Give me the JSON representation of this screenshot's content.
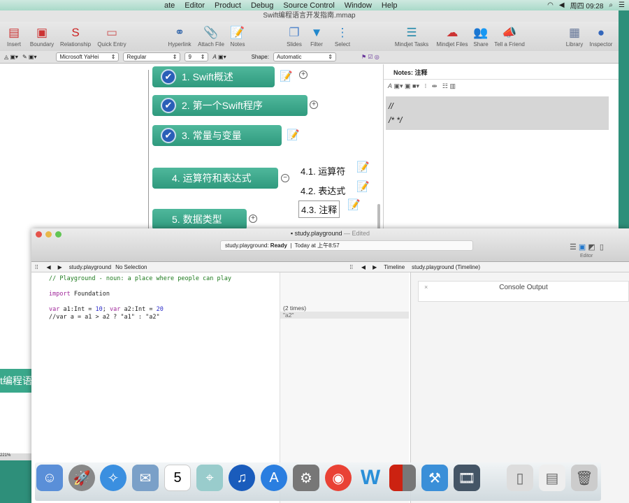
{
  "menubar": {
    "items": [
      "ate",
      "Editor",
      "Product",
      "Debug",
      "Source Control",
      "Window",
      "Help"
    ],
    "clock": "周四 09:28"
  },
  "mindjet": {
    "title": "Swift编程语言开发指南.mmap",
    "toolbar": [
      "Insert",
      "Boundary",
      "Relationship",
      "Quick Entry",
      "Hyperlink",
      "Attach File",
      "Notes",
      "Slides",
      "Filter",
      "Select",
      "Mindjet Tasks",
      "Mindjet Files",
      "Share",
      "Tell a Friend",
      "Library",
      "Inspector"
    ],
    "format": {
      "font": "Microsoft YaHei",
      "style": "Regular",
      "size": "9",
      "shape_label": "Shape:",
      "shape": "Automatic"
    },
    "topics": [
      "1. Swift概述",
      "2. 第一个Swift程序",
      "3. 常量与变量",
      "4. 运算符和表达式",
      "5. 数据类型"
    ],
    "subtopics": [
      "4.1. 运算符",
      "4.2. 表达式",
      "4.3. 注释"
    ],
    "notes": {
      "title": "Notes: 注释",
      "lines": [
        "//",
        "/*   */"
      ]
    },
    "side_label": "t编程语",
    "zoom": "221%"
  },
  "xcode": {
    "title": "study.playground",
    "edited": "— Edited",
    "status_file": "study.playground:",
    "status": "Ready",
    "status_time": "Today at 上午8:57",
    "editor_label": "Editor",
    "path_left": [
      "study.playground",
      "No Selection"
    ],
    "path_right": [
      "Timeline",
      "study.playground (Timeline)"
    ],
    "code": [
      "// Playground - noun: a place where people can play",
      "",
      "import Foundation",
      "",
      "var a1:Int  = 10; var a2:Int = 20",
      "//var a = a1 > a2 ? \"a1\" : \"a2\""
    ],
    "results": [
      "(2 times)",
      "\"a2\""
    ],
    "console": {
      "title": "Console Output",
      "close": "×"
    }
  },
  "dock": [
    "Finder",
    "Launchpad",
    "Safari",
    "Mail",
    "Calendar",
    "Maps",
    "iTunes",
    "App Store",
    "System Preferences",
    "Chrome",
    "Word",
    "Mindjet",
    "Xcode",
    "Photo Booth",
    "Preview",
    "Finder Window",
    "Trash"
  ],
  "colors": {
    "topic": "#3aa88b",
    "desktop": "#2e8f7a"
  }
}
